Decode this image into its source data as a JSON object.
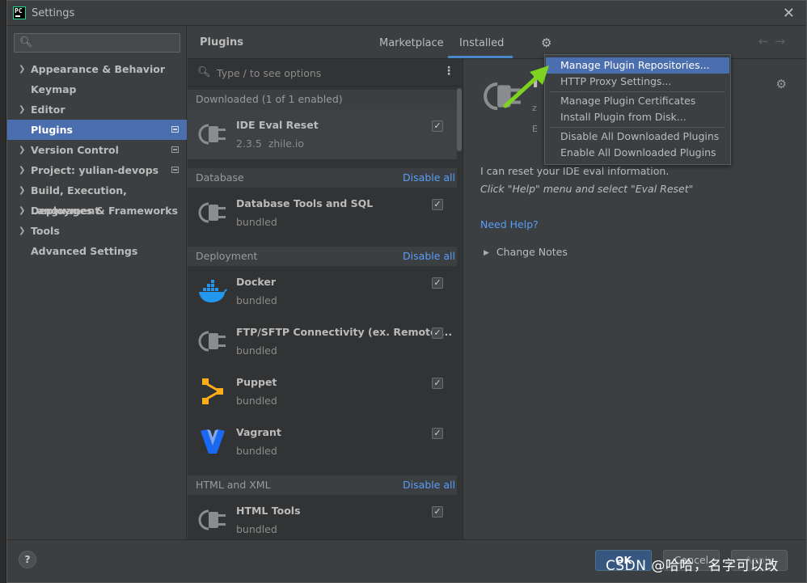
{
  "window": {
    "title": "Settings",
    "logo": "PC"
  },
  "sidebar": {
    "search_value": "",
    "items": [
      {
        "label": "Appearance & Behavior",
        "expandable": true,
        "selected": false,
        "marked": false
      },
      {
        "label": "Keymap",
        "expandable": false,
        "selected": false,
        "marked": false
      },
      {
        "label": "Editor",
        "expandable": true,
        "selected": false,
        "marked": false
      },
      {
        "label": "Plugins",
        "expandable": false,
        "selected": true,
        "marked": true
      },
      {
        "label": "Version Control",
        "expandable": true,
        "selected": false,
        "marked": true
      },
      {
        "label": "Project: yulian-devops",
        "expandable": true,
        "selected": false,
        "marked": true
      },
      {
        "label": "Build, Execution, Deployment",
        "expandable": true,
        "selected": false,
        "marked": false
      },
      {
        "label": "Languages & Frameworks",
        "expandable": true,
        "selected": false,
        "marked": false
      },
      {
        "label": "Tools",
        "expandable": true,
        "selected": false,
        "marked": false
      },
      {
        "label": "Advanced Settings",
        "expandable": false,
        "selected": false,
        "marked": false
      }
    ]
  },
  "header": {
    "title": "Plugins",
    "tabs": {
      "marketplace": "Marketplace",
      "installed": "Installed"
    },
    "active_tab": "Installed",
    "back_arrow": "←",
    "forward_arrow": "→"
  },
  "plugin_list": {
    "search_placeholder": "Type / to see options",
    "groups": [
      {
        "name": "Downloaded (1 of 1 enabled)",
        "action": ""
      },
      {
        "name": "Database",
        "action": "Disable all"
      },
      {
        "name": "Deployment",
        "action": "Disable all"
      },
      {
        "name": "HTML and XML",
        "action": "Disable all"
      }
    ],
    "plugins": [
      {
        "name": "IDE Eval Reset",
        "version": "2.3.5",
        "vendor": "zhile.io",
        "enabled": true,
        "icon": "plug-icon"
      },
      {
        "name": "Database Tools and SQL",
        "version": "bundled",
        "vendor": "",
        "enabled": true,
        "icon": "plug-icon"
      },
      {
        "name": "Docker",
        "version": "bundled",
        "vendor": "",
        "enabled": true,
        "icon": "docker-whale-icon"
      },
      {
        "name": "FTP/SFTP Connectivity (ex. Remote ...",
        "version": "bundled",
        "vendor": "",
        "enabled": true,
        "icon": "plug-icon"
      },
      {
        "name": "Puppet",
        "version": "bundled",
        "vendor": "",
        "enabled": true,
        "icon": "puppet-icon"
      },
      {
        "name": "Vagrant",
        "version": "bundled",
        "vendor": "",
        "enabled": true,
        "icon": "vagrant-icon"
      },
      {
        "name": "HTML Tools",
        "version": "bundled",
        "vendor": "",
        "enabled": true,
        "icon": "plug-icon"
      }
    ]
  },
  "detail": {
    "title_visible": "I",
    "vendor_initial": "z",
    "line2_initial": "E",
    "description": "I can reset your IDE eval information.",
    "instruction": "Click \"Help\" menu and select \"Eval Reset\"",
    "help_link": "Need Help?",
    "change_notes": "Change Notes"
  },
  "menu": {
    "items": [
      {
        "label": "Manage Plugin Repositories...",
        "highlighted": true
      },
      {
        "label": "HTTP Proxy Settings...",
        "highlighted": false
      },
      {
        "label": "Manage Plugin Certificates",
        "highlighted": false
      },
      {
        "label": "Install Plugin from Disk...",
        "highlighted": false
      },
      {
        "label": "Disable All Downloaded Plugins",
        "highlighted": false
      },
      {
        "label": "Enable All Downloaded Plugins",
        "highlighted": false
      }
    ]
  },
  "footer": {
    "help": "?",
    "ok": "OK",
    "cancel": "Cancel",
    "apply": "Apply",
    "watermark": "CSDN @哈哈，名字可以改"
  },
  "colors": {
    "accent": "#4b6eaf",
    "link": "#589df6",
    "arrow": "#7ed321",
    "ok_button": "#365880"
  }
}
